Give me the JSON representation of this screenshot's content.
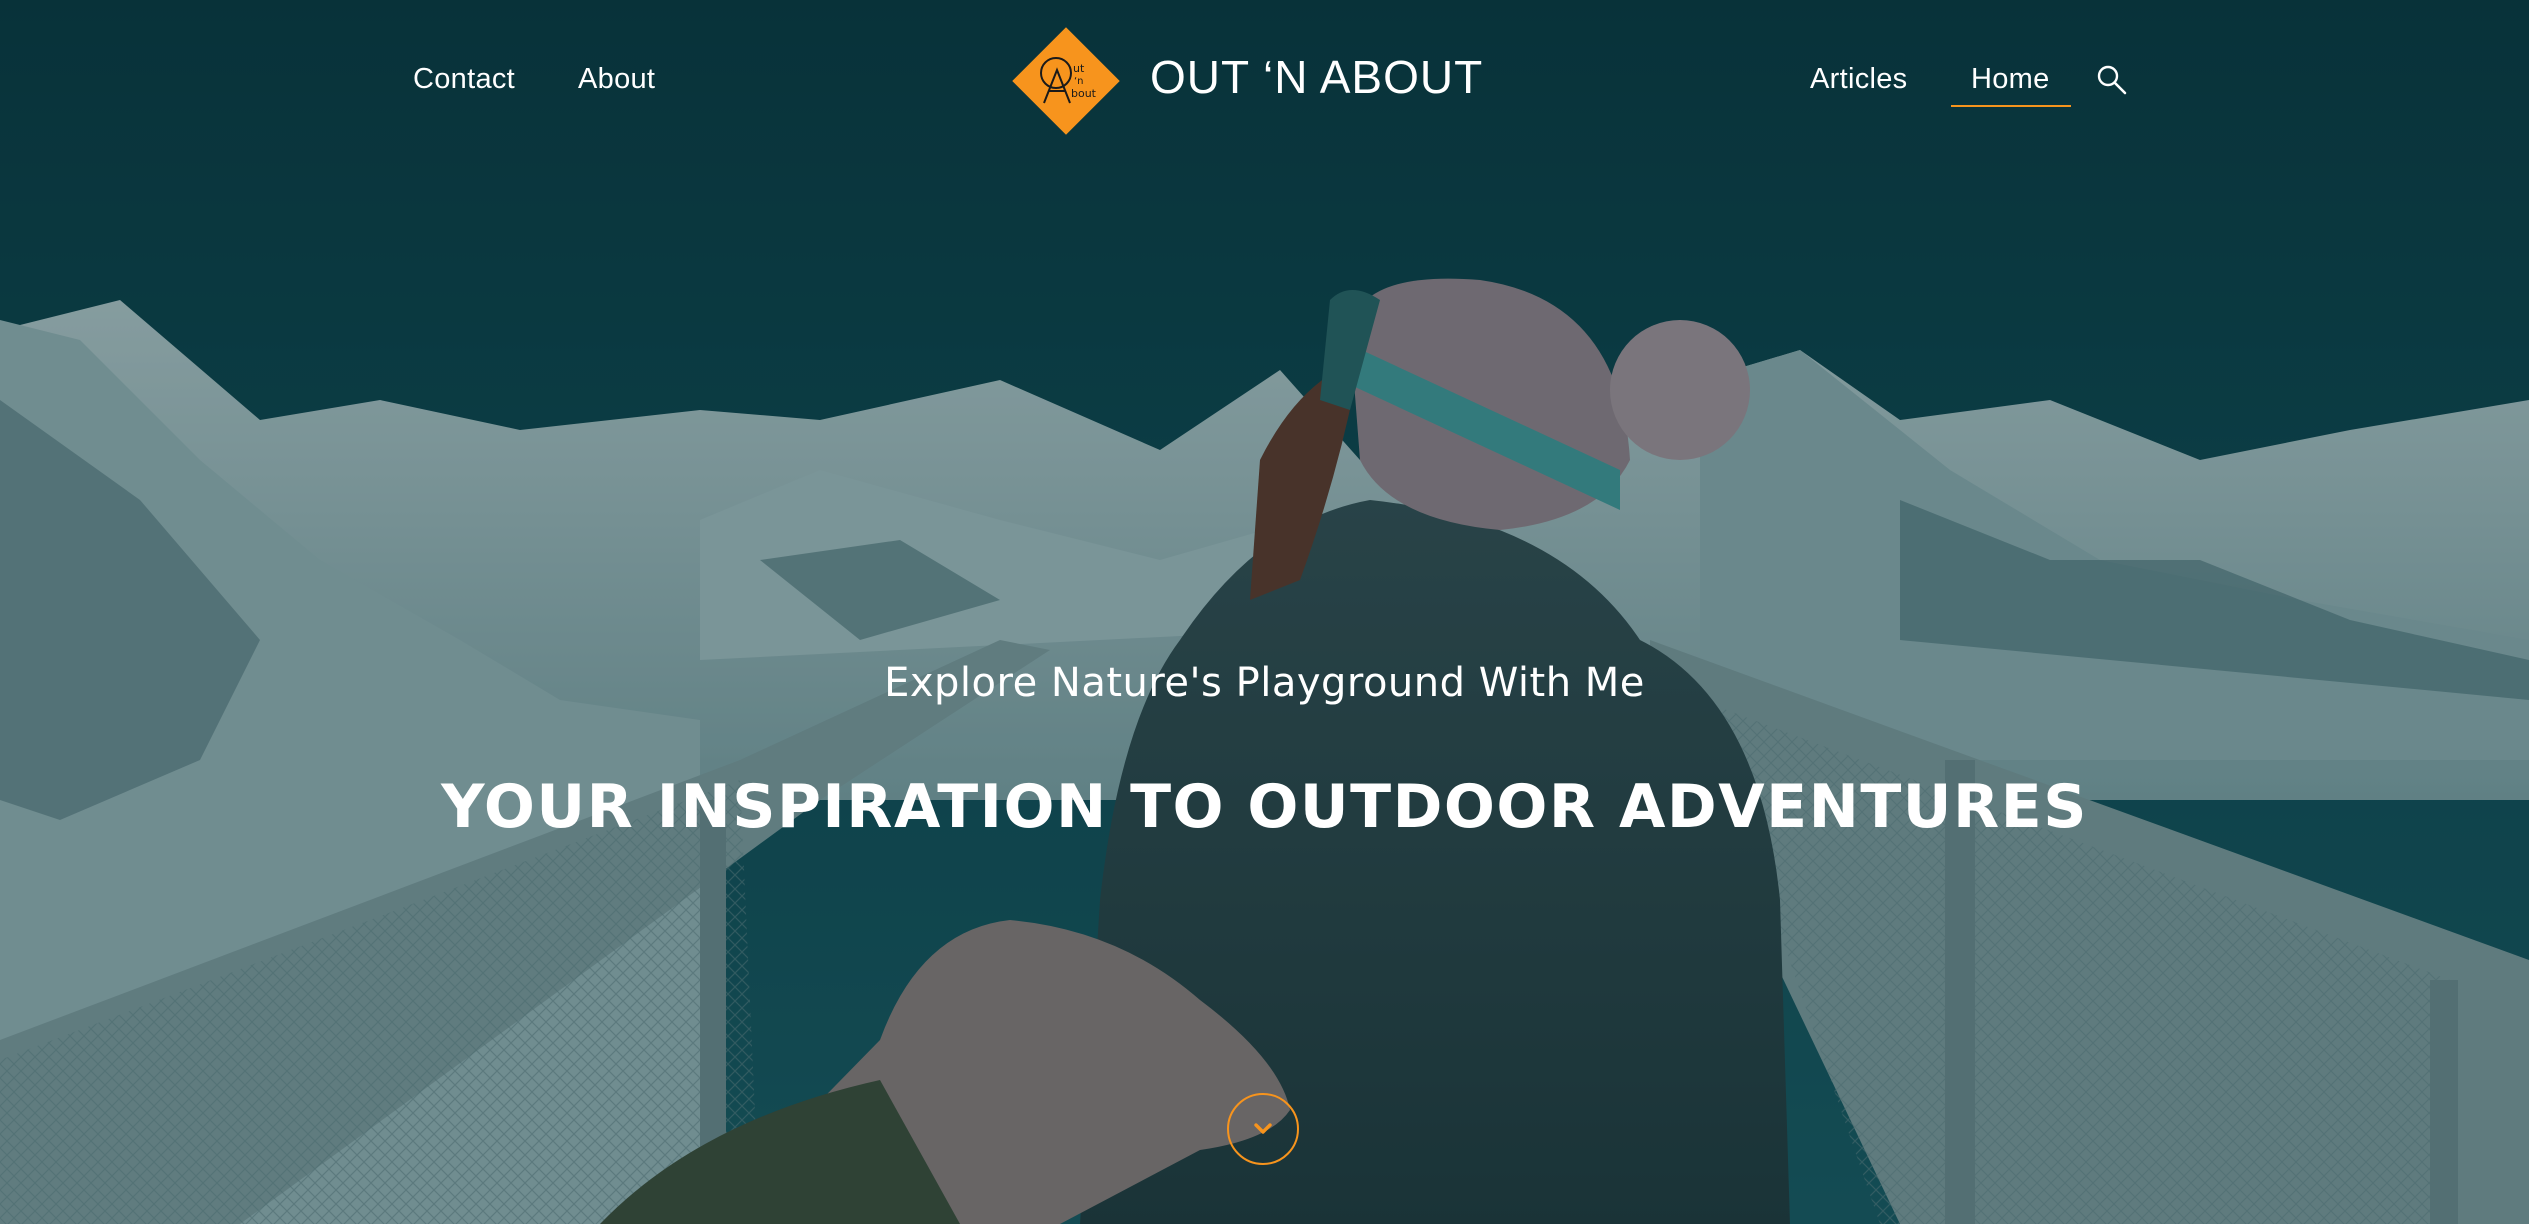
{
  "header": {
    "nav_left": [
      {
        "label": "Contact"
      },
      {
        "label": "About"
      }
    ],
    "nav_right": [
      {
        "label": "Articles"
      },
      {
        "label": "Home",
        "active": true
      }
    ],
    "logo": {
      "title": "OUT ‘N ABOUT",
      "mark_lines": [
        "ut",
        "‘n",
        "bout"
      ],
      "mark_initials": [
        "O",
        "A"
      ],
      "color": "#f7941d"
    },
    "search_icon": "search-icon"
  },
  "hero": {
    "subtitle": "Explore Nature's Playground With Me",
    "headline": "YOUR INSPIRATION TO OUTDOOR ADVENTURES",
    "scroll_icon": "chevron-down-icon"
  },
  "colors": {
    "accent": "#f7941d",
    "text": "#ffffff",
    "overlay_tint": "#0c4650"
  }
}
